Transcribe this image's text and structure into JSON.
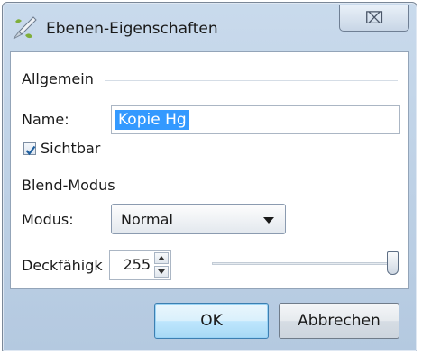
{
  "window": {
    "title": "Ebenen-Eigenschaften",
    "close_label": "⌧"
  },
  "general": {
    "group_label": "Allgemein",
    "name_label": "Name:",
    "name_value": "Kopie Hg",
    "visible_label": "Sichtbar",
    "visible_checked": true
  },
  "blend": {
    "group_label": "Blend-Modus",
    "mode_label": "Modus:",
    "mode_value": "Normal",
    "opacity_label": "Deckfähigk",
    "opacity_value": "255",
    "opacity_fraction": 1.0
  },
  "buttons": {
    "ok": "OK",
    "cancel": "Abbrechen"
  },
  "colors": {
    "selection": "#3399ff",
    "check": "#1f5f9e"
  }
}
